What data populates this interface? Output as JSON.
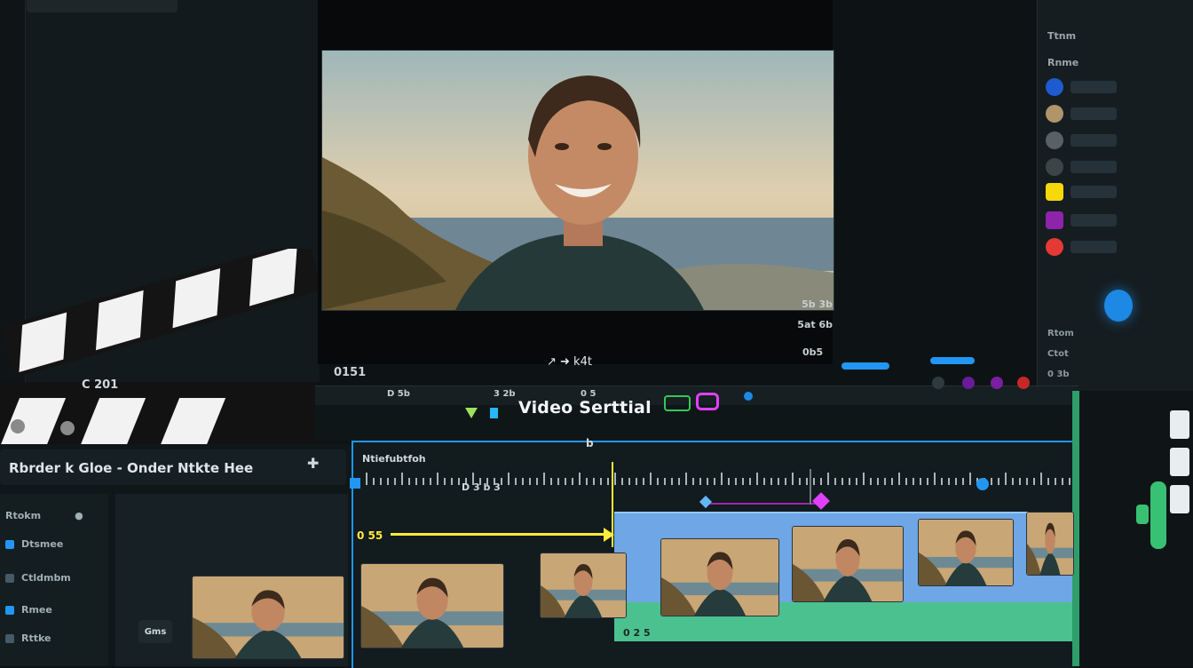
{
  "app": {
    "project_title": "Video Serttial"
  },
  "viewer": {
    "info_line_1": "5b  3b",
    "info_line_2": "5at  6b",
    "timecode_left": "0151",
    "controls_label": "↗ ➜ k4t",
    "info_right": "0b5"
  },
  "toolbar": {
    "labels": [
      "D 5b",
      "3 2b",
      "0 5"
    ],
    "clip_name": "C 201"
  },
  "timeline": {
    "header_label": "Rbrder  k Gloe - Onder Ntkte Hee",
    "ruler_label": "Ntiefubtfoh",
    "ruler_top": "b",
    "playhead_time": "D 3 b  3",
    "yellow_label": "0 55",
    "clip_time": "0 2 5",
    "button_label": "Gms",
    "list_items": [
      "Rtokm",
      "Dtsmee",
      "Ctldmbm",
      "Rmee",
      "Rttke"
    ]
  },
  "right_panel": {
    "label_1": "Ttnm",
    "label_2": "Rnme",
    "lower_label_1": "Rtom",
    "lower_label_2": "Ctot",
    "lower_label_3": "0 3b"
  },
  "colors": {
    "accent_blue": "#2196f3",
    "playhead_yellow": "#ffeb3b",
    "keyframe_purple": "#e040fb",
    "track_green": "#4cc190"
  }
}
